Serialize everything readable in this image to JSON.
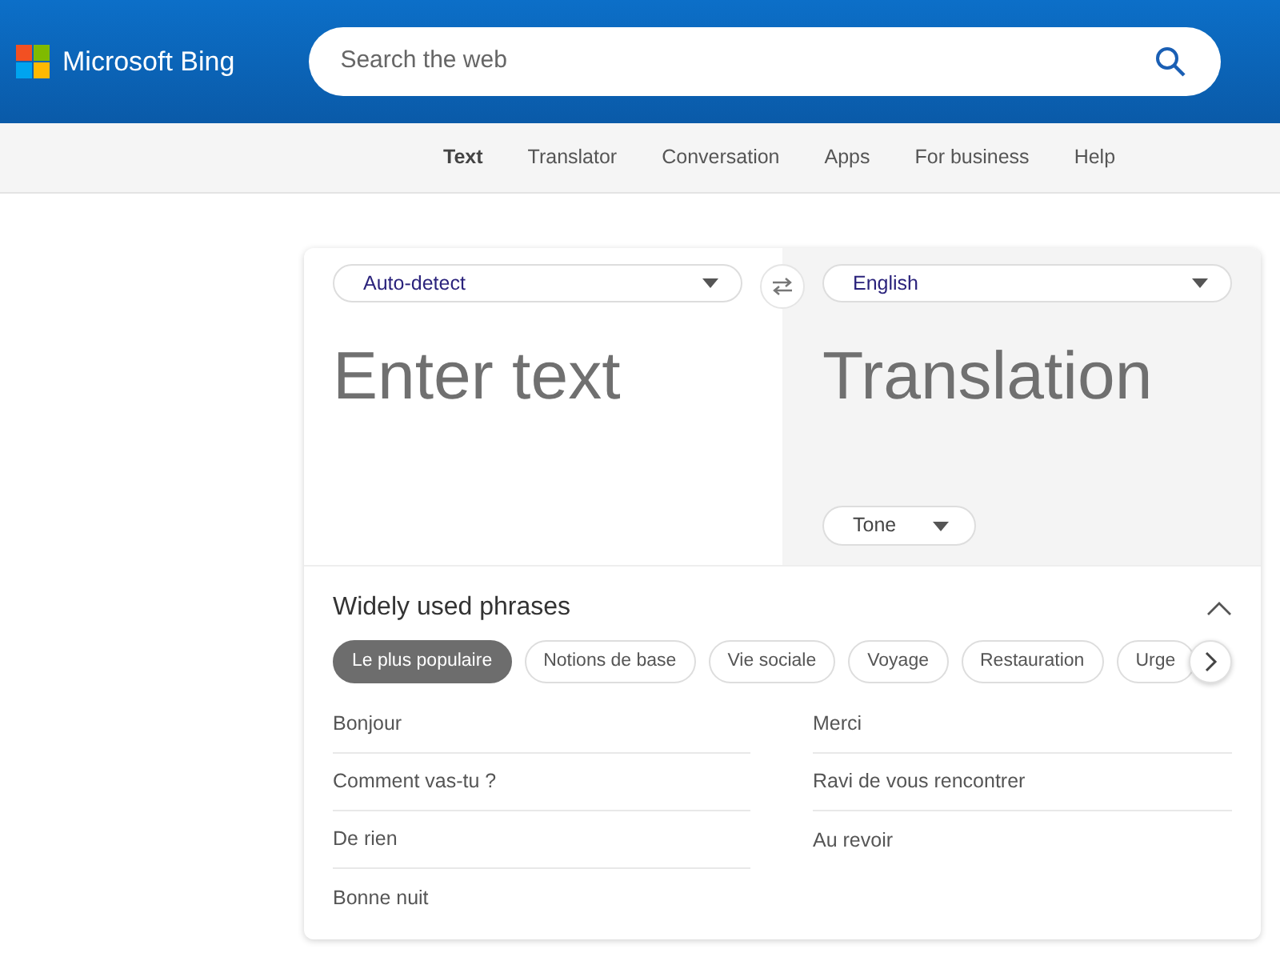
{
  "header": {
    "logo_text": "Microsoft Bing",
    "search": {
      "placeholder": "Search the web"
    }
  },
  "nav": [
    {
      "label": "Text",
      "selected": true
    },
    {
      "label": "Translator",
      "selected": false
    },
    {
      "label": "Conversation",
      "selected": false
    },
    {
      "label": "Apps",
      "selected": false
    },
    {
      "label": "For business",
      "selected": false
    },
    {
      "label": "Help",
      "selected": false
    }
  ],
  "translator": {
    "source_language": "Auto-detect",
    "target_language": "English",
    "input": {
      "placeholder": "Enter text"
    },
    "output_placeholder": "Translation",
    "tone": "Tone"
  },
  "phrases": {
    "title": "Widely used phrases",
    "expanded": true,
    "categories": [
      {
        "label": "Le plus populaire",
        "selected": true
      },
      {
        "label": "Notions de base",
        "selected": false
      },
      {
        "label": "Vie sociale",
        "selected": false
      },
      {
        "label": "Voyage",
        "selected": false
      },
      {
        "label": "Restauration",
        "selected": false
      },
      {
        "label": "Urge",
        "selected": false
      }
    ],
    "columns": [
      [
        "Bonjour",
        "Comment vas-tu ?",
        "De rien",
        "Bonne nuit"
      ],
      [
        "Merci",
        "Ravi de vous rencontrer",
        "Au revoir"
      ]
    ]
  }
}
